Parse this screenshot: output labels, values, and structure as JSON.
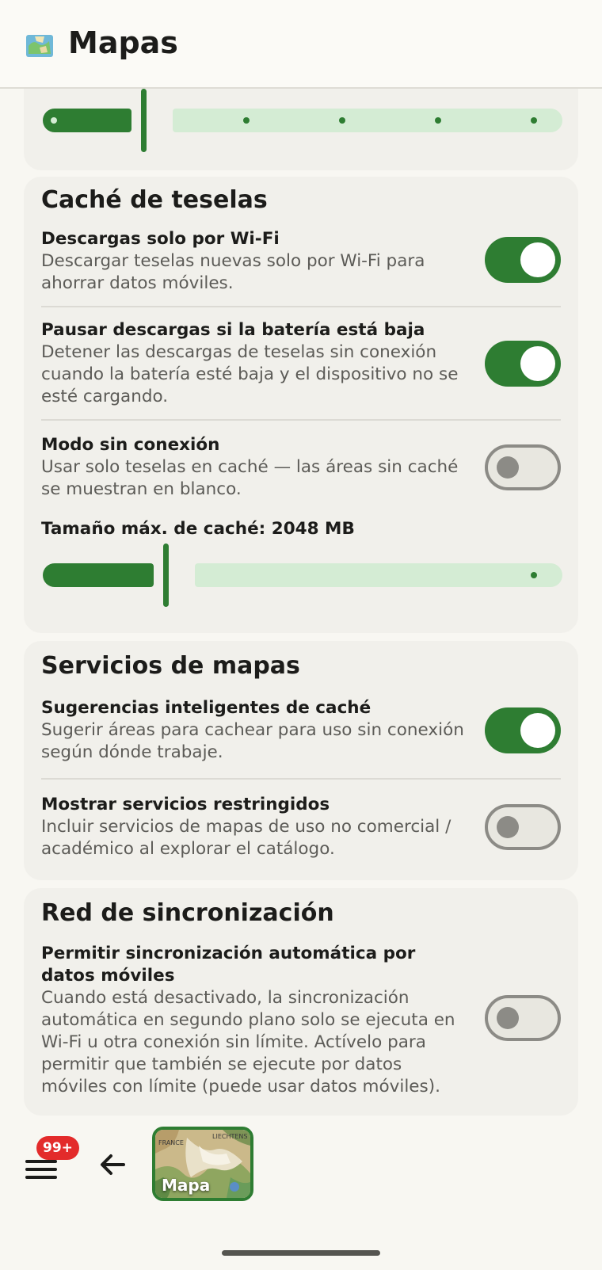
{
  "app": {
    "title": "Mapas"
  },
  "top_slider": {
    "ticks": 6,
    "active_fraction": 0.196
  },
  "tile_cache": {
    "title": "Caché de teselas",
    "settings": [
      {
        "title": "Descargas solo por Wi-Fi",
        "desc": "Descargar teselas nuevas solo por Wi-Fi para ahorrar datos móviles.",
        "enabled": true
      },
      {
        "title": "Pausar descargas si la batería está baja",
        "desc": "Detener las descargas de teselas sin conexión cuando la batería esté baja y el dispositivo no se esté cargando.",
        "enabled": true
      },
      {
        "title": "Modo sin conexión",
        "desc": "Usar solo teselas en caché — las áreas sin caché se muestran en blanco.",
        "enabled": false
      }
    ],
    "max_cache_label": "Tamaño máx. de caché: 2048 MB",
    "max_cache_fraction": 0.24
  },
  "map_services": {
    "title": "Servicios de mapas",
    "settings": [
      {
        "title": "Sugerencias inteligentes de caché",
        "desc": "Sugerir áreas para cachear para uso sin conexión según dónde trabaje.",
        "enabled": true
      },
      {
        "title": "Mostrar servicios restringidos",
        "desc": "Incluir servicios de mapas de uso no comercial / académico al explorar el catálogo.",
        "enabled": false
      }
    ]
  },
  "sync_network": {
    "title": "Red de sincronización",
    "settings": [
      {
        "title": "Permitir sincronización automática por datos móviles",
        "desc": "Cuando está desactivado, la sincronización automática en segundo plano solo se ejecuta en Wi-Fi u otra conexión sin límite. Actívelo para permitir que también se ejecute por datos móviles con límite (puede usar datos móviles).",
        "enabled": false
      }
    ]
  },
  "bottom_bar": {
    "badge": "99+",
    "map_label": "Mapa",
    "map_place_1": "FRANCE",
    "map_place_2": "LIECHTENS"
  },
  "colors": {
    "accent": "#2e7d32",
    "track_inactive": "#d4ecd4",
    "badge": "#e32b2b"
  }
}
